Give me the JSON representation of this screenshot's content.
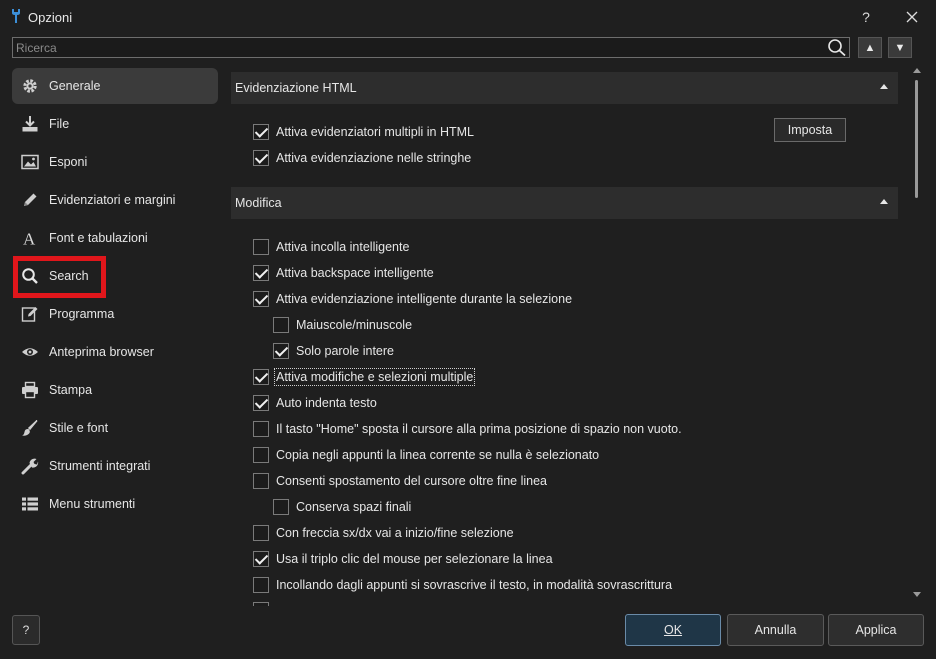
{
  "window": {
    "title": "Opzioni",
    "help_label": "?",
    "close_label": "✕"
  },
  "search": {
    "placeholder": "Ricerca",
    "value": ""
  },
  "nav": {
    "up_label": "▲",
    "down_label": "▼"
  },
  "sidebar": {
    "items": [
      {
        "label": "Generale",
        "icon": "gear-icon",
        "active": true
      },
      {
        "label": "File",
        "icon": "download-icon"
      },
      {
        "label": "Esponi",
        "icon": "image-icon"
      },
      {
        "label": "Evidenziatori e margini",
        "icon": "pencil-icon"
      },
      {
        "label": "Font e tabulazioni",
        "icon": "font-icon"
      },
      {
        "label": "Search",
        "icon": "search-icon"
      },
      {
        "label": "Programma",
        "icon": "edit-box-icon"
      },
      {
        "label": "Anteprima browser",
        "icon": "eye-icon"
      },
      {
        "label": "Stampa",
        "icon": "printer-icon"
      },
      {
        "label": "Stile e font",
        "icon": "brush-icon"
      },
      {
        "label": "Strumenti integrati",
        "icon": "wrench-icon"
      },
      {
        "label": "Menu strumenti",
        "icon": "list-icon"
      }
    ]
  },
  "sections": {
    "html": {
      "title": "Evidenziazione HTML",
      "imposta_label": "Imposta",
      "options": [
        {
          "label": "Attiva evidenziatori multipli in HTML",
          "checked": true
        },
        {
          "label": "Attiva evidenziazione nelle stringhe",
          "checked": true
        }
      ]
    },
    "modifica": {
      "title": "Modifica",
      "options": [
        {
          "label": "Attiva incolla intelligente",
          "checked": false
        },
        {
          "label": "Attiva backspace intelligente",
          "checked": true
        },
        {
          "label": "Attiva evidenziazione intelligente durante la selezione",
          "checked": true
        },
        {
          "label": "Maiuscole/minuscole",
          "checked": false
        },
        {
          "label": "Solo parole intere",
          "checked": true
        },
        {
          "label": "Attiva modifiche e selezioni multiple",
          "checked": true
        },
        {
          "label": "Auto indenta testo",
          "checked": true
        },
        {
          "label": "Il tasto \"Home\" sposta il cursore alla prima posizione di spazio non vuoto.",
          "checked": false
        },
        {
          "label": "Copia negli appunti la linea corrente se nulla è selezionato",
          "checked": false
        },
        {
          "label": "Consenti spostamento del cursore oltre fine linea",
          "checked": false
        },
        {
          "label": "Conserva spazi finali",
          "checked": false
        },
        {
          "label": "Con freccia sx/dx vai a inizio/fine selezione",
          "checked": false
        },
        {
          "label": "Usa il triplo clic del mouse per selezionare la linea",
          "checked": true
        },
        {
          "label": "Incollando dagli appunti si sovrascrive il testo, in modalità sovrascrittura",
          "checked": false
        }
      ]
    }
  },
  "footer": {
    "help_label": "?",
    "ok_label": "OK",
    "annulla_label": "Annulla",
    "applica_label": "Applica"
  },
  "colors": {
    "background": "#1f1f1f",
    "section_header": "#2d2d2d",
    "highlight": "#e0161b",
    "ok_border": "#6a8ba8"
  }
}
